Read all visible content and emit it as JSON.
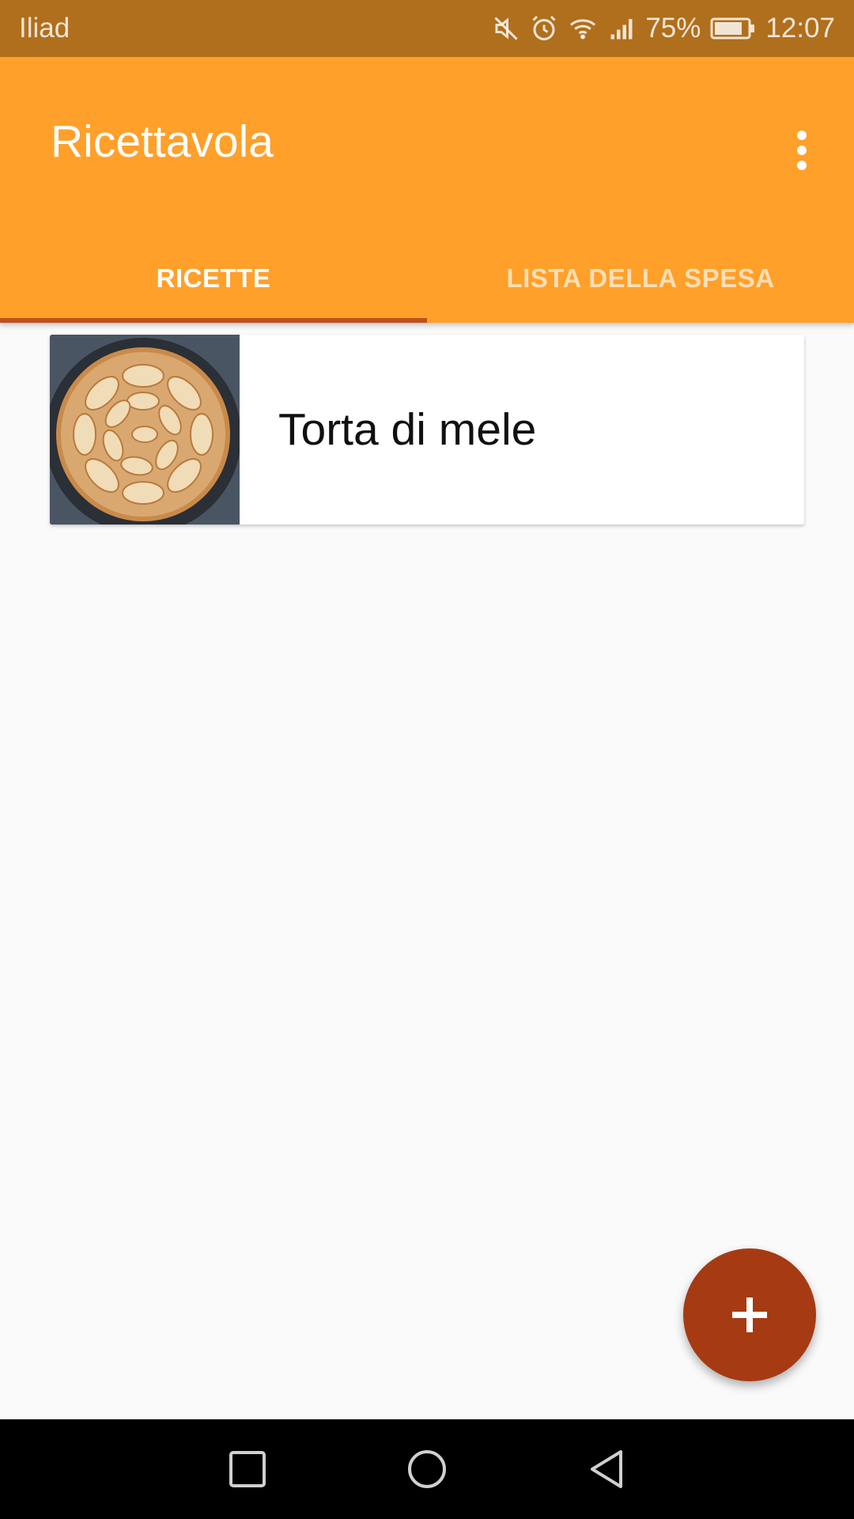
{
  "status_bar": {
    "carrier": "Iliad",
    "battery": "75%",
    "time": "12:07",
    "icons": [
      "mute-icon",
      "alarm-icon",
      "wifi-icon",
      "signal-icon",
      "battery-icon"
    ]
  },
  "app_bar": {
    "title": "Ricettavola",
    "menu_icon": "more-vert-icon"
  },
  "tabs": [
    {
      "label": "RICETTE",
      "active": true
    },
    {
      "label": "LISTA DELLA SPESA",
      "active": false
    }
  ],
  "recipes": [
    {
      "name": "Torta di mele",
      "image": "apple-pie-thumbnail"
    }
  ],
  "fab": {
    "icon": "plus-icon"
  },
  "nav_bar": {
    "buttons": [
      "recents-icon",
      "home-icon",
      "back-icon"
    ]
  },
  "colors": {
    "status_bar": "#b06f1d",
    "primary": "#ffa02a",
    "accent": "#a63a13",
    "tab_indicator": "#c0501c",
    "background": "#fafafa"
  }
}
